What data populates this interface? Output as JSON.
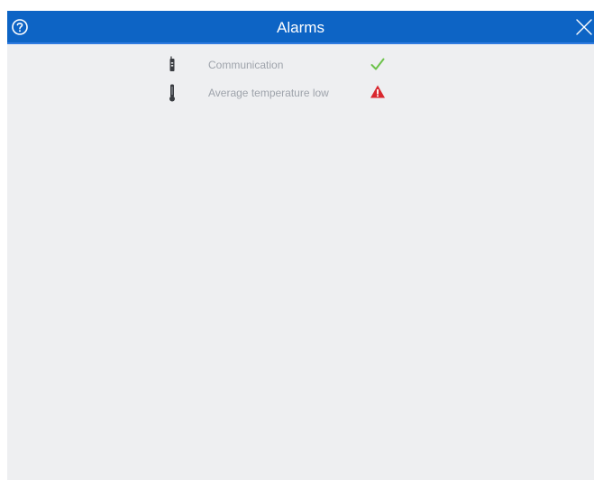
{
  "dialog": {
    "title": "Alarms",
    "help_icon": "help-circle-icon",
    "close_icon": "close-icon",
    "header_color": "#0d64c5"
  },
  "alarms": [
    {
      "label": "Communication",
      "type_icon": "communication-device-icon",
      "status": "ok",
      "status_icon": "checkmark-icon",
      "status_color": "#6cc24a"
    },
    {
      "label": "Average temperature low",
      "type_icon": "thermometer-icon",
      "status": "warning",
      "status_icon": "warning-triangle-icon",
      "status_color": "#d9272e"
    }
  ]
}
